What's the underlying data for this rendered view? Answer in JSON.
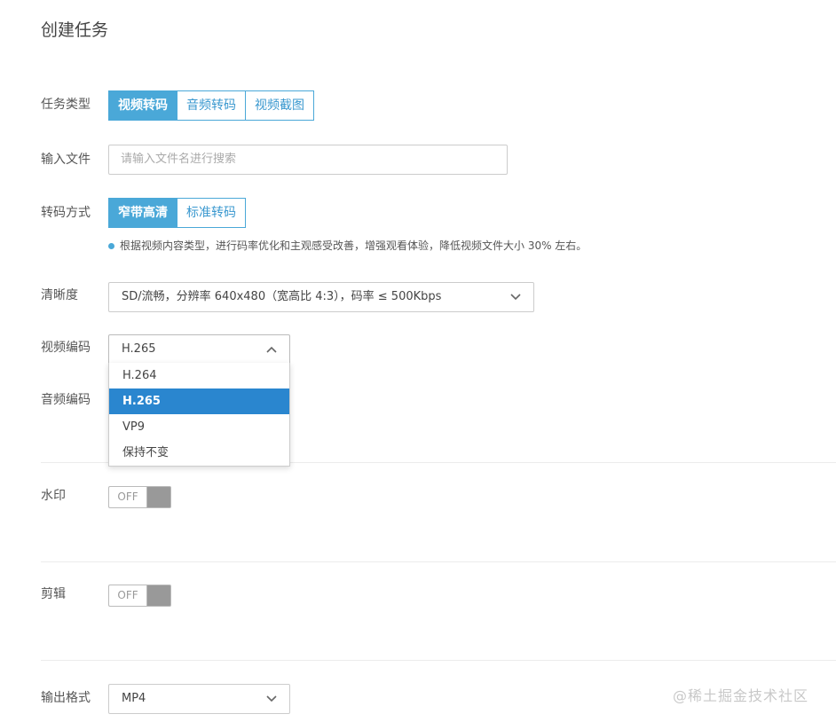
{
  "title": "创建任务",
  "task_type": {
    "label": "任务类型",
    "options": [
      "视频转码",
      "音频转码",
      "视频截图"
    ]
  },
  "input_file": {
    "label": "输入文件",
    "placeholder": "请输入文件名进行搜索"
  },
  "transcode_mode": {
    "label": "转码方式",
    "options": [
      "窄带高清",
      "标准转码"
    ],
    "hint": "根据视频内容类型，进行码率优化和主观感受改善，增强观看体验，降低视频文件大小 30% 左右。"
  },
  "clarity": {
    "label": "清晰度",
    "value": "SD/流畅，分辨率 640x480（宽高比 4:3），码率 ≤ 500Kbps"
  },
  "video_codec": {
    "label": "视频编码",
    "value": "H.265",
    "options": [
      "H.264",
      "H.265",
      "VP9",
      "保持不变"
    ]
  },
  "audio_codec": {
    "label": "音频编码"
  },
  "watermark_toggle": {
    "label": "水印",
    "state": "OFF"
  },
  "clip_toggle": {
    "label": "剪辑",
    "state": "OFF"
  },
  "output_format": {
    "label": "输出格式",
    "value": "MP4"
  },
  "site_watermark": "@稀土掘金技术社区",
  "colors": {
    "accent": "#4aa8d8",
    "selected_item": "#2a86cf",
    "toggle_off": "#999999"
  }
}
